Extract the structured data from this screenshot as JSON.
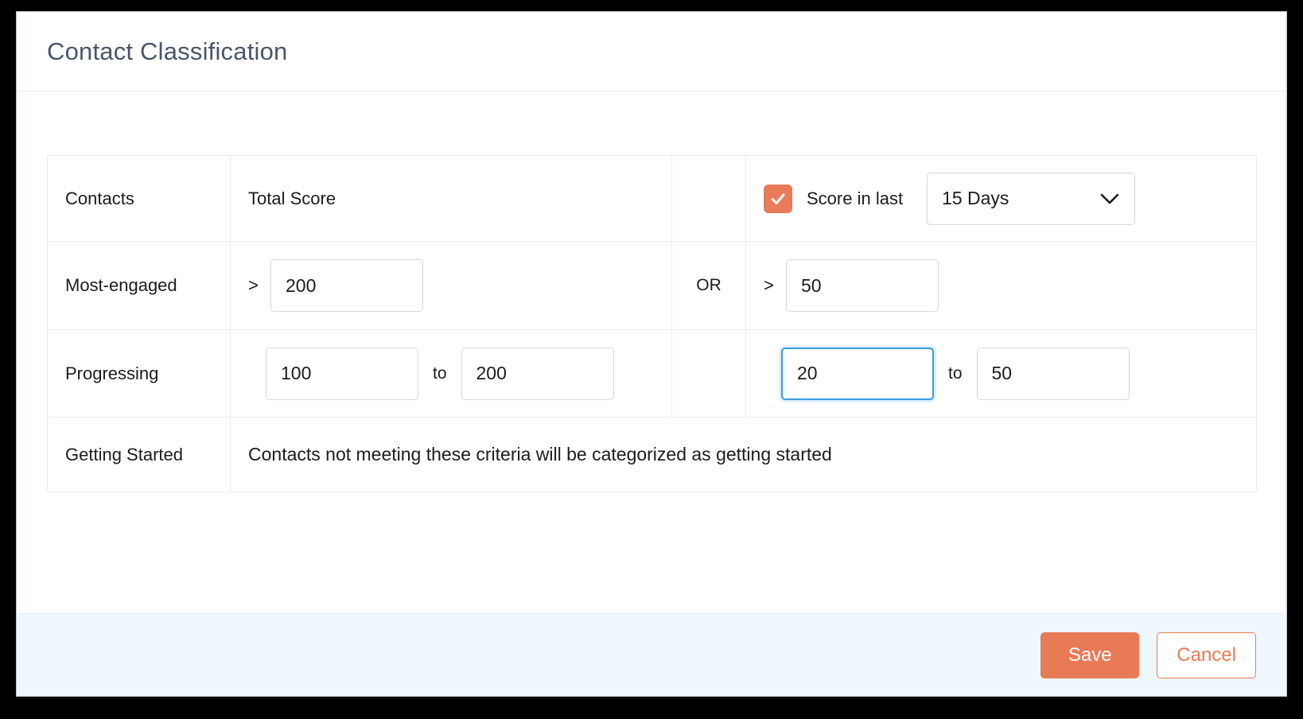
{
  "dialog": {
    "title": "Contact Classification"
  },
  "table": {
    "headers": {
      "contacts": "Contacts",
      "total_score": "Total Score"
    },
    "score_in_last": {
      "checkbox_checked": true,
      "label": "Score in last",
      "select_value": "15 Days",
      "chevron_icon": "chevron-down-icon"
    },
    "or_label": "OR",
    "rows": [
      {
        "name": "Most-engaged",
        "left": {
          "operator": ">",
          "value": "200"
        },
        "right": {
          "operator": ">",
          "value": "50"
        }
      },
      {
        "name": "Progressing",
        "left": {
          "from": "100",
          "joiner": "to",
          "to": "200"
        },
        "right": {
          "from": "20",
          "joiner": "to",
          "to": "50",
          "from_focused": true
        }
      }
    ],
    "getting_started": {
      "name": "Getting Started",
      "description": "Contacts not meeting these criteria will be categorized as getting started"
    }
  },
  "footer": {
    "save_label": "Save",
    "cancel_label": "Cancel"
  },
  "colors": {
    "accent_orange": "#e97a56",
    "checkbox_orange": "#e87b5a",
    "focus_blue": "#3a9ee0",
    "footer_bg": "#eef8fc",
    "title_text": "#4a5668"
  }
}
